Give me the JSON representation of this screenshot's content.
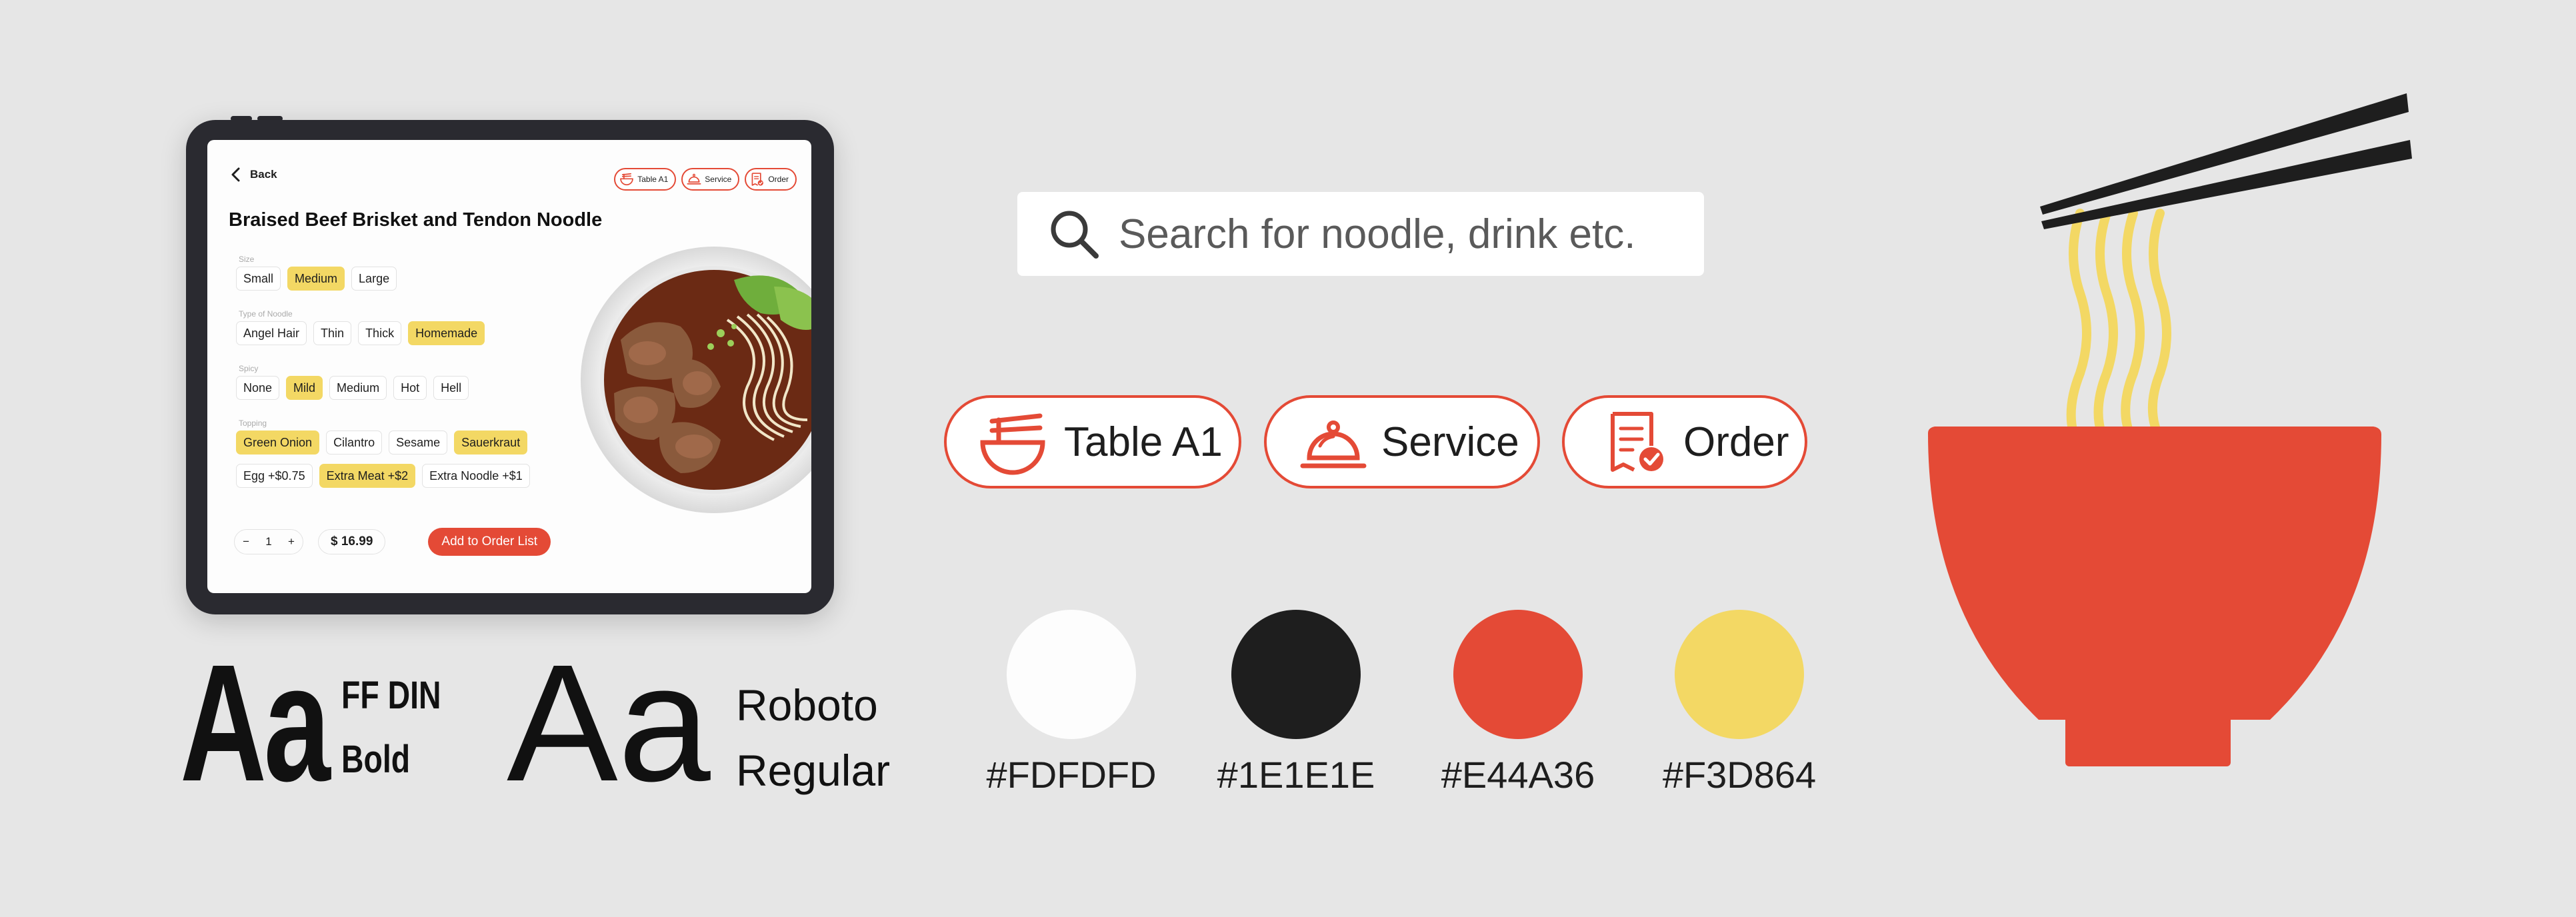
{
  "colors": {
    "white": "#FDFDFD",
    "black": "#1E1E1E",
    "red": "#E44A36",
    "yellow": "#F3D864",
    "background": "#E6E6E6"
  },
  "tablet": {
    "back_label": "Back",
    "top_buttons": [
      {
        "label": "Table A1",
        "icon": "noodle-bowl-icon"
      },
      {
        "label": "Service",
        "icon": "service-bell-icon"
      },
      {
        "label": "Order",
        "icon": "order-receipt-icon"
      }
    ],
    "dish_title": "Braised Beef Brisket and Tendon Noodle",
    "options": [
      {
        "label": "Size",
        "chips": [
          {
            "text": "Small",
            "selected": false
          },
          {
            "text": "Medium",
            "selected": true
          },
          {
            "text": "Large",
            "selected": false
          }
        ]
      },
      {
        "label": "Type of Noodle",
        "chips": [
          {
            "text": "Angel Hair",
            "selected": false
          },
          {
            "text": "Thin",
            "selected": false
          },
          {
            "text": "Thick",
            "selected": false
          },
          {
            "text": "Homemade",
            "selected": true
          }
        ]
      },
      {
        "label": "Spicy",
        "chips": [
          {
            "text": "None",
            "selected": false
          },
          {
            "text": "Mild",
            "selected": true
          },
          {
            "text": "Medium",
            "selected": false
          },
          {
            "text": "Hot",
            "selected": false
          },
          {
            "text": "Hell",
            "selected": false
          }
        ]
      },
      {
        "label": "Topping",
        "chips": [
          {
            "text": "Green Onion",
            "selected": true
          },
          {
            "text": "Cilantro",
            "selected": false
          },
          {
            "text": "Sesame",
            "selected": false
          },
          {
            "text": "Sauerkraut",
            "selected": true
          }
        ]
      }
    ],
    "topping_row2": [
      {
        "text": "Egg +$0.75",
        "selected": false
      },
      {
        "text": "Extra Meat +$2",
        "selected": true
      },
      {
        "text": "Extra Noodle +$1",
        "selected": false
      }
    ],
    "quantity": {
      "minus": "−",
      "value": "1",
      "plus": "+"
    },
    "price": "$ 16.99",
    "add_button": "Add to Order List"
  },
  "typography": {
    "sample": "Aa",
    "font1_line1": "FF DIN",
    "font1_line2": "Bold",
    "font2_line1": "Roboto",
    "font2_line2": "Regular"
  },
  "search": {
    "placeholder": "Search for noodle, drink etc.",
    "icon": "search-icon"
  },
  "big_buttons": {
    "table": "Table A1",
    "service": "Service",
    "order": "Order"
  },
  "swatches": [
    {
      "hex": "#FDFDFD",
      "label": "#FDFDFD"
    },
    {
      "hex": "#1E1E1E",
      "label": "#1E1E1E"
    },
    {
      "hex": "#E44A36",
      "label": "#E44A36"
    },
    {
      "hex": "#F3D864",
      "label": "#F3D864"
    }
  ]
}
